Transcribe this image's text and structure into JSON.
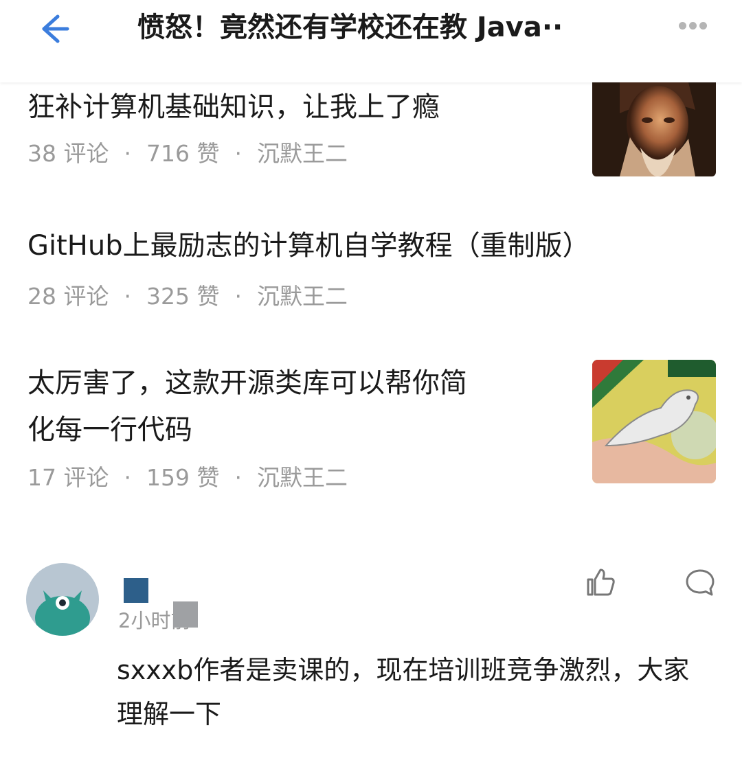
{
  "header": {
    "title": "愤怒！竟然还有学校还在教 Java··",
    "back_icon": "back-arrow-icon",
    "more_icon": "more-dots-icon",
    "accent_color": "#3b7ddd"
  },
  "articles": [
    {
      "title": "狂补计算机基础知识，让我上了瘾",
      "comments": "38 评论",
      "likes": "716 赞",
      "author": "沉默王二",
      "has_thumbnail": true,
      "thumbnail": "portrait-painting"
    },
    {
      "title": "GitHub上最励志的计算机自学教程（重制版）",
      "comments": "28 评论",
      "likes": "325 赞",
      "author": "沉默王二",
      "has_thumbnail": false
    },
    {
      "title_line1": "太厉害了，这款开源类库可以帮你简",
      "title_line2": "化每一行代码",
      "comments": "17 评论",
      "likes": "159 赞",
      "author": "沉默王二",
      "has_thumbnail": true,
      "thumbnail": "mosaic-bird"
    }
  ],
  "separator": "·",
  "comment": {
    "time": "2小时前",
    "text_line1": "sxxxb作者是卖课的，现在培训班竞争激烈，大家",
    "text_line2": "理解一下",
    "like_icon": "thumbs-up-icon",
    "reply_icon": "comment-bubble-icon"
  }
}
